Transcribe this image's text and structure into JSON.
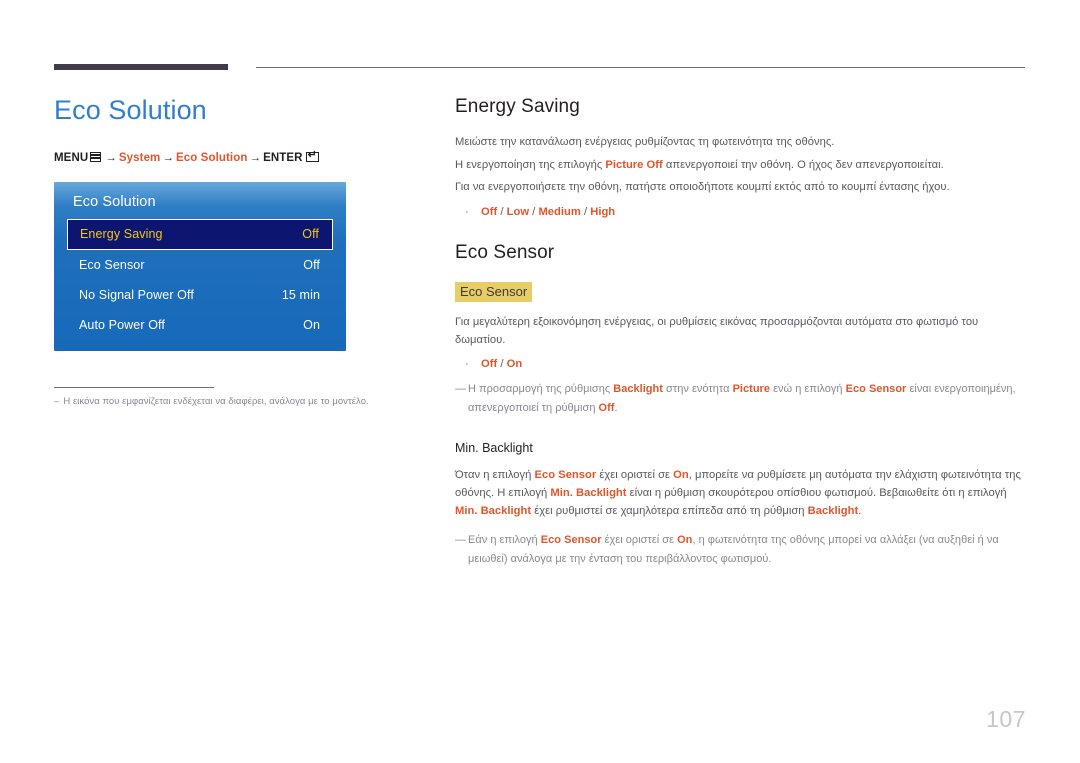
{
  "page": {
    "number": "107"
  },
  "left": {
    "title": "Eco Solution",
    "breadcrumb": {
      "menu_label": "MENU",
      "menu_icon": "menu-grid-icon",
      "arrow": "→",
      "step1": "System",
      "step2": "Eco Solution",
      "enter_label": "ENTER",
      "enter_icon": "enter-key-icon"
    },
    "osd": {
      "title": "Eco Solution",
      "rows": [
        {
          "label": "Energy Saving",
          "value": "Off",
          "selected": true
        },
        {
          "label": "Eco Sensor",
          "value": "Off",
          "selected": false
        },
        {
          "label": "No Signal Power Off",
          "value": "15 min",
          "selected": false
        },
        {
          "label": "Auto Power Off",
          "value": "On",
          "selected": false
        }
      ]
    },
    "footnote": {
      "dash": "–",
      "text": "Η εικόνα που εμφανίζεται ενδέχεται να διαφέρει, ανάλογα με το μοντέλο."
    }
  },
  "right": {
    "energy_saving": {
      "heading": "Energy Saving",
      "p1": "Μειώστε την κατανάλωση ενέργειας ρυθμίζοντας τη φωτεινότητα της οθόνης.",
      "p2_a": "Η ενεργοποίηση της επιλογής ",
      "p2_accent": "Picture Off",
      "p2_b": " απενεργοποιεί την οθόνη. Ο ήχος δεν απενεργοποιείται.",
      "p3": "Για να ενεργοποιήσετε την οθόνη, πατήστε οποιοδήποτε κουμπί εκτός από το κουμπί έντασης ήχου.",
      "bullet_dot": "·",
      "options": [
        "Off",
        "Low",
        "Medium",
        "High"
      ],
      "options_sep": " / "
    },
    "eco_sensor": {
      "heading": "Eco Sensor",
      "tag": "Eco Sensor",
      "p1": "Για μεγαλύτερη εξοικονόμηση ενέργειας, οι ρυθμίσεις εικόνας προσαρμόζονται αυτόματα στο φωτισμό του δωματίου.",
      "bullet_dot": "·",
      "options": [
        "Off",
        "On"
      ],
      "options_sep": " / ",
      "note_dash": "—",
      "note_a": "Η προσαρμογή της ρύθμισης ",
      "note_b1": "Backlight",
      "note_b": " στην ενότητα ",
      "note_b2": "Picture",
      "note_c": " ενώ η επιλογή ",
      "note_b3": "Eco Sensor",
      "note_d": " είναι ενεργοποιημένη, απενεργοποιεί τη ρύθμιση ",
      "note_b4": "Off",
      "note_e": "."
    },
    "min_backlight": {
      "heading": "Min. Backlight",
      "p_a": "Όταν η επιλογή ",
      "p_b1": "Eco Sensor",
      "p_b": " έχει οριστεί σε ",
      "p_b2": "On",
      "p_c": ", μπορείτε να ρυθμίσετε μη αυτόματα την ελάχιστη φωτεινότητα της οθόνης. Η επιλογή ",
      "p_b3": "Min. Backlight",
      "p_d": " είναι η ρύθμιση σκουρότερου οπίσθιου φωτισμού. Βεβαιωθείτε ότι η επιλογή ",
      "p_b4": "Min. Backlight",
      "p_e": " έχει ρυθμιστεί σε χαμηλότερα επίπεδα από τη ρύθμιση ",
      "p_b5": "Backlight",
      "p_f": ".",
      "note_dash": "—",
      "note_a": "Εάν η επιλογή ",
      "note_b1": "Eco Sensor",
      "note_b": " έχει οριστεί σε ",
      "note_b2": "On",
      "note_c": ", η φωτεινότητα της οθόνης μπορεί να αλλάξει (να αυξηθεί ή να μειωθεί) ανάλογα με την ένταση του περιβάλλοντος φωτισμού."
    }
  },
  "colors": {
    "accent_orange": "#e0562a",
    "title_blue": "#2f7fd0",
    "osd_blue": "#1769b9",
    "osd_selected_bg": "#0c1570",
    "osd_selected_text": "#f5c518",
    "highlight_yellow": "#e8cd67",
    "body_gray": "#5a585f",
    "note_gray": "#8a8890",
    "page_number_gray": "#c7c6cc"
  }
}
